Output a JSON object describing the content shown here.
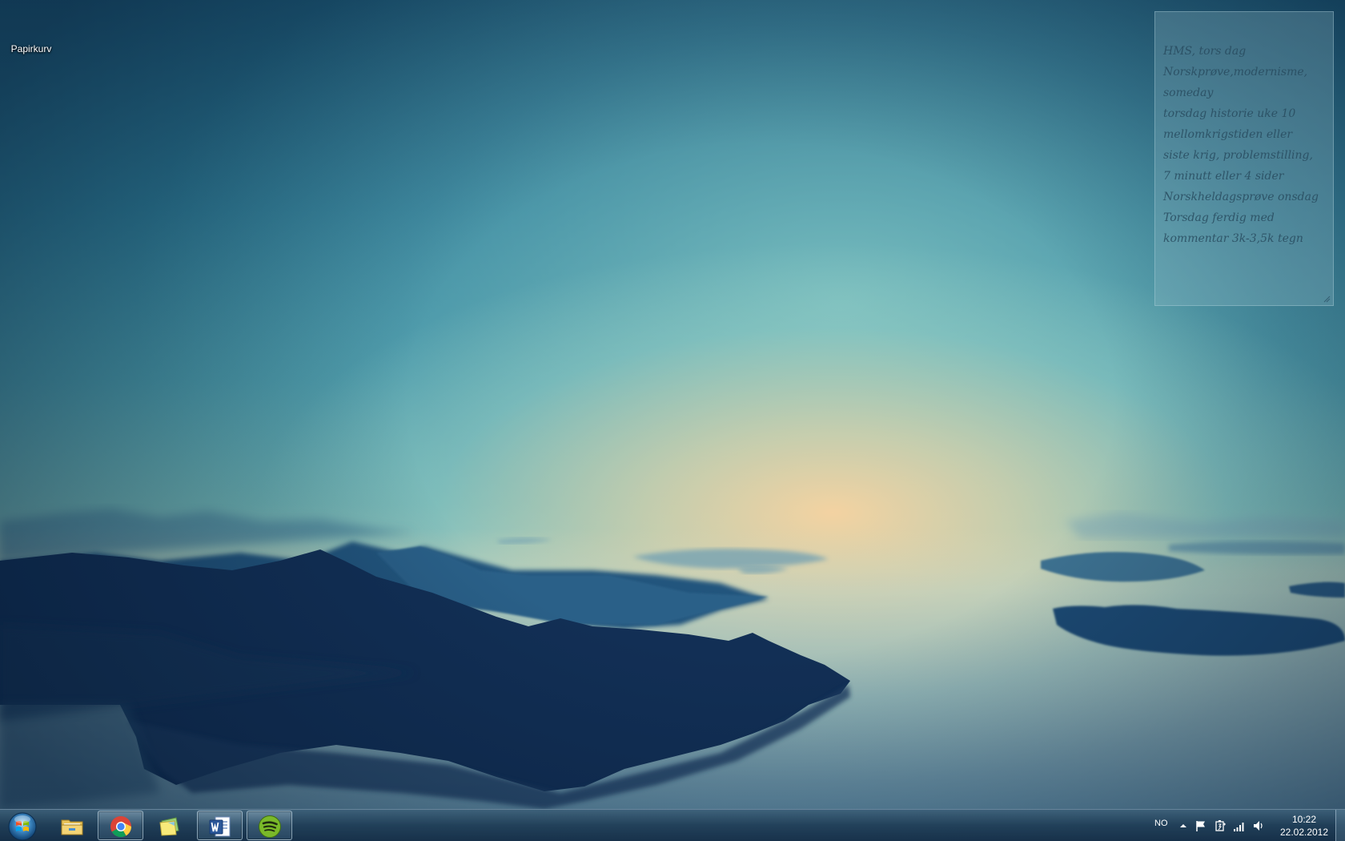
{
  "desktop": {
    "icons": [
      {
        "label": "Papirkurv",
        "icon": "recycle-bin-icon"
      }
    ]
  },
  "sticky_note": {
    "lines": [
      "HMS, tors dag",
      "Norskprøve,modernisme,",
      "someday",
      "torsdag historie uke 10",
      "mellomkrigstiden eller",
      "siste krig, problemstilling,",
      "7 minutt eller 4 sider",
      "Norskheldagsprøve onsdag",
      "Torsdag ferdig med",
      "kommentar 3k-3,5k tegn"
    ]
  },
  "taskbar": {
    "start_icon": "windows-start-orb-icon",
    "pinned": [
      {
        "name": "windows-explorer",
        "icon": "folder-icon",
        "active": false
      },
      {
        "name": "google-chrome",
        "icon": "chrome-icon",
        "active": true
      },
      {
        "name": "sticky-notes",
        "icon": "sticky-notes-icon",
        "active": false
      },
      {
        "name": "microsoft-word",
        "icon": "word-icon",
        "active": true
      },
      {
        "name": "spotify",
        "icon": "spotify-icon",
        "active": true
      }
    ],
    "tray": {
      "language": "NO",
      "icons": [
        "show-hidden-icons-icon",
        "action-center-flag-icon",
        "power-icon",
        "network-signal-icon",
        "volume-icon"
      ],
      "time": "10:22",
      "date": "22.02.2012"
    }
  }
}
